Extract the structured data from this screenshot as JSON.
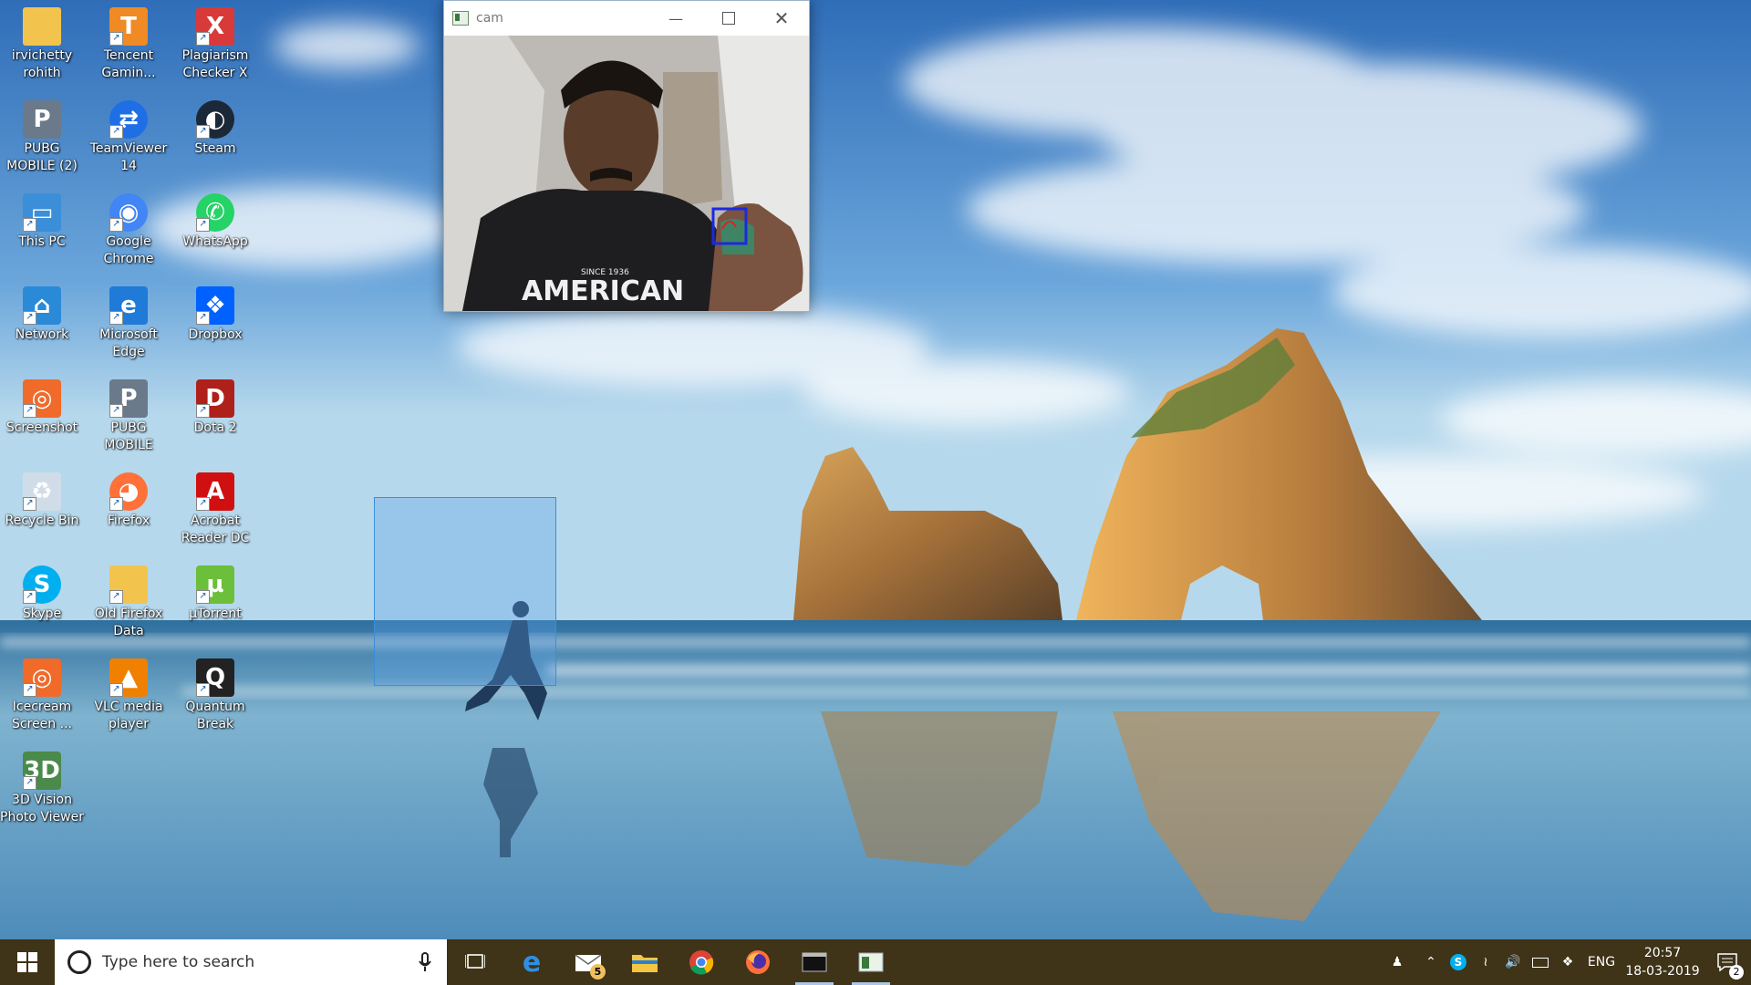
{
  "desktop": {
    "icons": [
      {
        "label": "irvichetty\nrohith",
        "icon": "folder-user-icon"
      },
      {
        "label": "Tencent\nGamin...",
        "icon": "tencent-gaming-icon"
      },
      {
        "label": "Plagiarism\nChecker X",
        "icon": "plagiarism-checker-icon"
      },
      {
        "label": "PUBG\nMOBILE (2)",
        "icon": "pubg-icon"
      },
      {
        "label": "TeamViewer\n14",
        "icon": "teamviewer-icon"
      },
      {
        "label": "Steam",
        "icon": "steam-icon"
      },
      {
        "label": "This PC",
        "icon": "this-pc-icon"
      },
      {
        "label": "Google\nChrome",
        "icon": "chrome-icon"
      },
      {
        "label": "WhatsApp",
        "icon": "whatsapp-icon"
      },
      {
        "label": "Network",
        "icon": "network-icon"
      },
      {
        "label": "Microsoft\nEdge",
        "icon": "edge-icon"
      },
      {
        "label": "Dropbox",
        "icon": "dropbox-icon"
      },
      {
        "label": "Screenshot",
        "icon": "screenshot-icon"
      },
      {
        "label": "PUBG\nMOBILE",
        "icon": "pubg-icon"
      },
      {
        "label": "Dota 2",
        "icon": "dota2-icon"
      },
      {
        "label": "Recycle Bin",
        "icon": "recycle-bin-icon"
      },
      {
        "label": "Firefox",
        "icon": "firefox-icon"
      },
      {
        "label": "Acrobat\nReader DC",
        "icon": "acrobat-icon"
      },
      {
        "label": "Skype",
        "icon": "skype-icon"
      },
      {
        "label": "Old Firefox\nData",
        "icon": "folder-icon"
      },
      {
        "label": "µTorrent",
        "icon": "utorrent-icon"
      },
      {
        "label": "Icecream\nScreen ...",
        "icon": "icecream-icon"
      },
      {
        "label": "VLC media\nplayer",
        "icon": "vlc-icon"
      },
      {
        "label": "Quantum\nBreak",
        "icon": "quantum-break-icon"
      },
      {
        "label": "3D Vision\nPhoto Viewer",
        "icon": "3d-vision-icon"
      }
    ]
  },
  "cam_window": {
    "title": "cam",
    "shirt_text": "AMERICAN",
    "shirt_small": "SINCE 1936"
  },
  "taskbar": {
    "search_placeholder": "Type here to search",
    "mail_badge": "5",
    "language": "ENG",
    "time": "20:57",
    "date": "18-03-2019",
    "notification_count": "2"
  }
}
